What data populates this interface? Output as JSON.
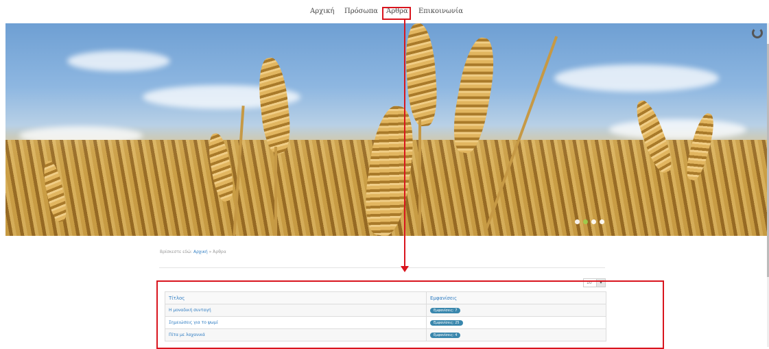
{
  "nav": {
    "items": [
      "Αρχική",
      "Πρόσωπα",
      "Άρθρα",
      "Επικοινωνία"
    ]
  },
  "hero": {
    "slide_count": 4,
    "active_slide": 1
  },
  "breadcrumb": {
    "prefix": "Βρίσκεστε εδώ:",
    "home": "Αρχική",
    "separator": "»",
    "current": "Άρθρα"
  },
  "list_limit": {
    "value": "10"
  },
  "table": {
    "headers": [
      "Τίτλος",
      "Εμφανίσεις"
    ],
    "rows": [
      {
        "title": "Η μοναδική συνταγή",
        "hits": "Εμφανίσεις: 7"
      },
      {
        "title": "Σημειώσεις για το ψωμί",
        "hits": "Εμφανίσεις: 25"
      },
      {
        "title": "Πίτα με λαχανικά",
        "hits": "Εμφανίσεις: 4"
      }
    ]
  },
  "colors": {
    "annotation_red": "#d9141d",
    "link_blue": "#2e7cc2",
    "badge_blue": "#3a87ad",
    "active_dot": "#9ccf4e"
  }
}
